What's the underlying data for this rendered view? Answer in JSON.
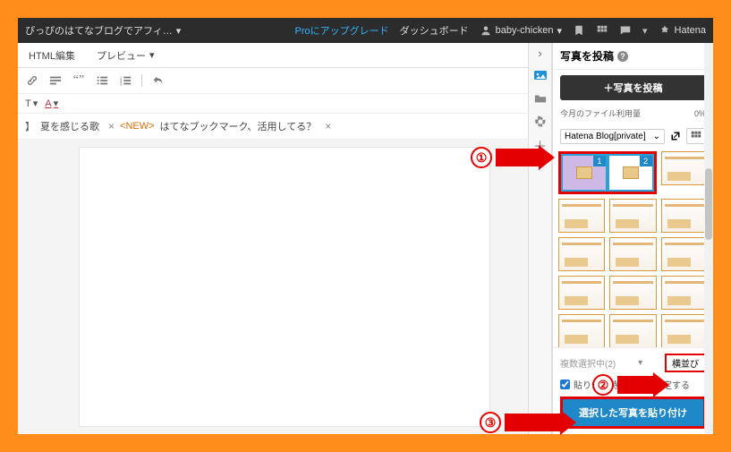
{
  "topbar": {
    "blog_title": "ぴっぴのはてなブログでアフィ…",
    "pro_link": "Proにアップグレード",
    "dashboard": "ダッシュボード",
    "username": "baby-chicken",
    "brand": "Hatena"
  },
  "tabs": {
    "html_edit": "HTML編集",
    "preview": "プレビュー"
  },
  "format": {
    "t_label": "T",
    "a_label": "A"
  },
  "post": {
    "tag1": "夏を感じる歌",
    "tag_new": "<NEW>",
    "tag2": "はてなブックマーク、活用してる？"
  },
  "panel": {
    "title": "写真を投稿",
    "upload_btn": "＋写真を投稿",
    "usage_label": "今月のファイル利用量",
    "usage_value": "0%",
    "source": "Hatena Blog[private]",
    "selected_badges": [
      "1",
      "2"
    ],
    "layout_label": "複数選択中(2)",
    "layout_btn": "横並び",
    "checkbox_label": "貼り付け時に詳細を設定する",
    "paste_btn": "選択した写真を貼り付け"
  },
  "annotations": {
    "n1": "①",
    "n2": "②",
    "n3": "③"
  }
}
